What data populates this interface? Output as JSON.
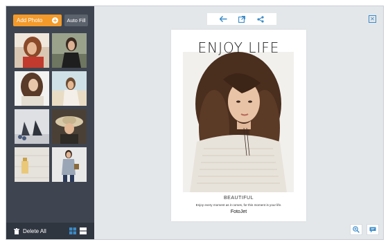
{
  "sidebar": {
    "add_photo_label": "Add Photo",
    "auto_fill_label": "Auto Fill",
    "delete_all_label": "Delete All",
    "thumbnails": [
      {
        "name": "photo-woman-red-top"
      },
      {
        "name": "photo-woman-leaning"
      },
      {
        "name": "photo-woman-curly-hair"
      },
      {
        "name": "photo-woman-beach"
      },
      {
        "name": "photo-high-heel-shoes"
      },
      {
        "name": "photo-woman-hat"
      },
      {
        "name": "photo-perfume-bottle"
      },
      {
        "name": "photo-woman-standing"
      }
    ]
  },
  "toolbar": {
    "icons": [
      "back-arrow-icon",
      "open-external-icon",
      "share-icon"
    ]
  },
  "poster": {
    "title": "ENJOY LIFE",
    "subtitle": "BEAUTIFUL",
    "tagline": "Enjoy every moment as it comes, for this moment is your life.",
    "brand": "FotoJet"
  },
  "colors": {
    "accent": "#f39a2b",
    "sidebar_bg": "#3e4550",
    "canvas_bg": "#e4e7ea",
    "icon_blue": "#3a8bc8"
  }
}
